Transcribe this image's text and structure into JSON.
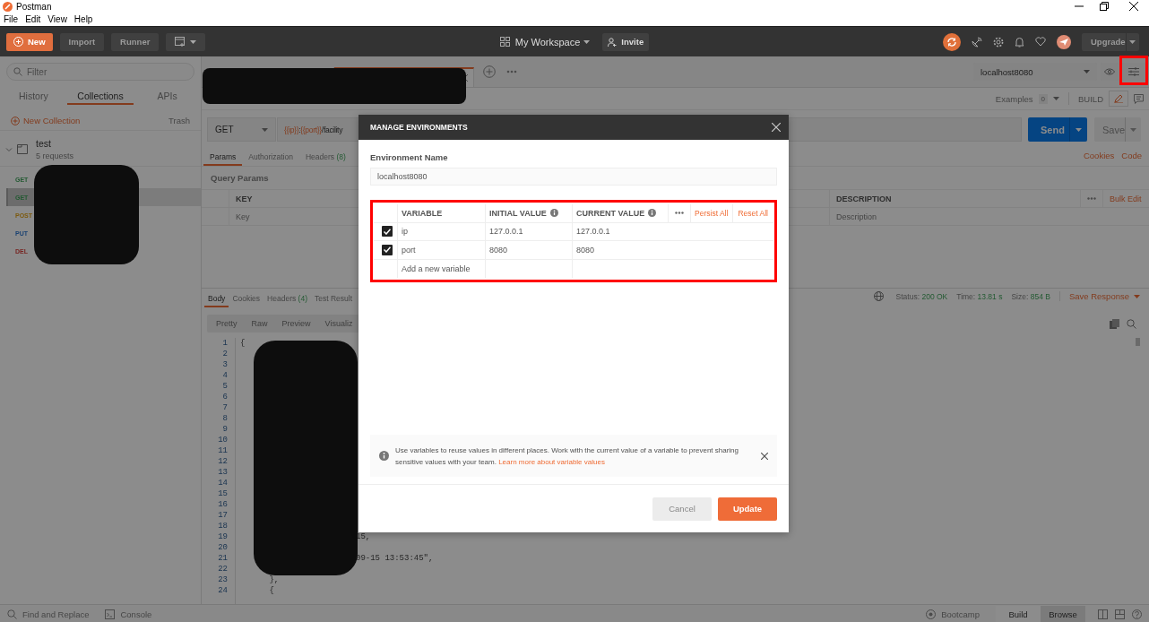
{
  "window": {
    "title": "Postman",
    "menu": [
      "File",
      "Edit",
      "View",
      "Help"
    ]
  },
  "header": {
    "new_button": "New",
    "import_button": "Import",
    "runner_button": "Runner",
    "workspace": "My Workspace",
    "invite_button": "Invite",
    "upgrade_button": "Upgrade"
  },
  "sidebar": {
    "filter_placeholder": "Filter",
    "tabs": [
      {
        "label": "History",
        "selected": false
      },
      {
        "label": "Collections",
        "selected": true
      },
      {
        "label": "APIs",
        "selected": false
      }
    ],
    "new_collection": "New Collection",
    "trash": "Trash",
    "collection": {
      "name": "test",
      "count": "5 requests",
      "expanded": true
    },
    "requests": [
      {
        "method": "GET",
        "color": "#235a32",
        "selected": false
      },
      {
        "method": "GET",
        "color": "#235a32",
        "selected": true
      },
      {
        "method": "POST",
        "color": "#7d5a0e",
        "selected": false
      },
      {
        "method": "PUT",
        "color": "#1a4272",
        "selected": false
      },
      {
        "method": "DEL",
        "color": "#772522",
        "selected": false
      }
    ]
  },
  "environment": {
    "selected": "localhost8080"
  },
  "request": {
    "examples_label": "Examples",
    "examples_count": "0",
    "build_label": "BUILD",
    "method": "GET",
    "url_parts": [
      {
        "text": "{{ip}}",
        "kind": "variable"
      },
      {
        "text": ":",
        "kind": "plain"
      },
      {
        "text": "{{port}}",
        "kind": "variable"
      },
      {
        "text": "/facility",
        "kind": "plain"
      }
    ],
    "send_button": "Send",
    "save_button": "Save",
    "tabs": [
      {
        "label": "Params",
        "selected": true
      },
      {
        "label": "Authorization",
        "selected": false
      },
      {
        "label": "Headers",
        "count": "(8)",
        "selected": false
      }
    ],
    "links": [
      "Cookies",
      "Code"
    ],
    "params_title": "Query Params",
    "columns": [
      "KEY",
      "DESCRIPTION"
    ],
    "bulk_edit": "Bulk Edit",
    "key_placeholder": "Key",
    "description_placeholder": "Description"
  },
  "response": {
    "tabs": [
      {
        "label": "Body",
        "selected": true
      },
      {
        "label": "Cookies",
        "selected": false
      },
      {
        "label": "Headers",
        "count": "(4)",
        "selected": false
      },
      {
        "label": "Test Result",
        "selected": false
      }
    ],
    "stats": [
      {
        "label": "Status:",
        "value": "200 OK"
      },
      {
        "label": "Time:",
        "value": "13.81 s"
      },
      {
        "label": "Size:",
        "value": "854 B"
      }
    ],
    "save_response": "Save Response",
    "views": [
      "Pretty",
      "Raw",
      "Preview",
      "Visualiz"
    ],
    "code_lines": [
      {
        "number": "1",
        "text": "{",
        "kind": "plain"
      },
      {
        "number": "2"
      },
      {
        "number": "3"
      },
      {
        "number": "4"
      },
      {
        "number": "5"
      },
      {
        "number": "6"
      },
      {
        "number": "7"
      },
      {
        "number": "8"
      },
      {
        "number": "9"
      },
      {
        "number": "10"
      },
      {
        "number": "11"
      },
      {
        "number": "12"
      },
      {
        "number": "13"
      },
      {
        "number": "14"
      },
      {
        "number": "15"
      },
      {
        "number": "16"
      },
      {
        "number": "17"
      },
      {
        "number": "18"
      },
      {
        "number": "19",
        "text": "15,",
        "kind": "after-mask"
      },
      {
        "number": "20"
      },
      {
        "number": "21",
        "text": "09-15 13:53:45\",",
        "kind": "after-mask"
      },
      {
        "number": "22"
      },
      {
        "number": "23",
        "text": "      },",
        "kind": "plain"
      },
      {
        "number": "24",
        "text": "      {",
        "kind": "plain"
      }
    ]
  },
  "footer": {
    "find_replace": "Find and Replace",
    "console": "Console",
    "bootcamp": "Bootcamp",
    "modes": [
      {
        "label": "Build",
        "selected": true
      },
      {
        "label": "Browse",
        "selected": false
      }
    ]
  },
  "modal": {
    "title": "MANAGE ENVIRONMENTS",
    "name_label": "Environment Name",
    "name_value": "localhost8080",
    "columns": [
      {
        "label": "VARIABLE",
        "info": false
      },
      {
        "label": "INITIAL VALUE",
        "info": true
      },
      {
        "label": "CURRENT VALUE",
        "info": true
      }
    ],
    "persist_all": "Persist All",
    "reset_all": "Reset All",
    "variables": [
      {
        "checked": true,
        "name": "ip",
        "initial": "127.0.0.1",
        "current": "127.0.0.1"
      },
      {
        "checked": true,
        "name": "port",
        "initial": "8080",
        "current": "8080"
      }
    ],
    "new_placeholder": "Add a new variable",
    "info": {
      "text": "Use variables to reuse values in different places. Work with the current value of a variable to prevent sharing sensitive values with your team.",
      "link": "Learn more about variable values"
    },
    "cancel_button": "Cancel",
    "update_button": "Update"
  }
}
